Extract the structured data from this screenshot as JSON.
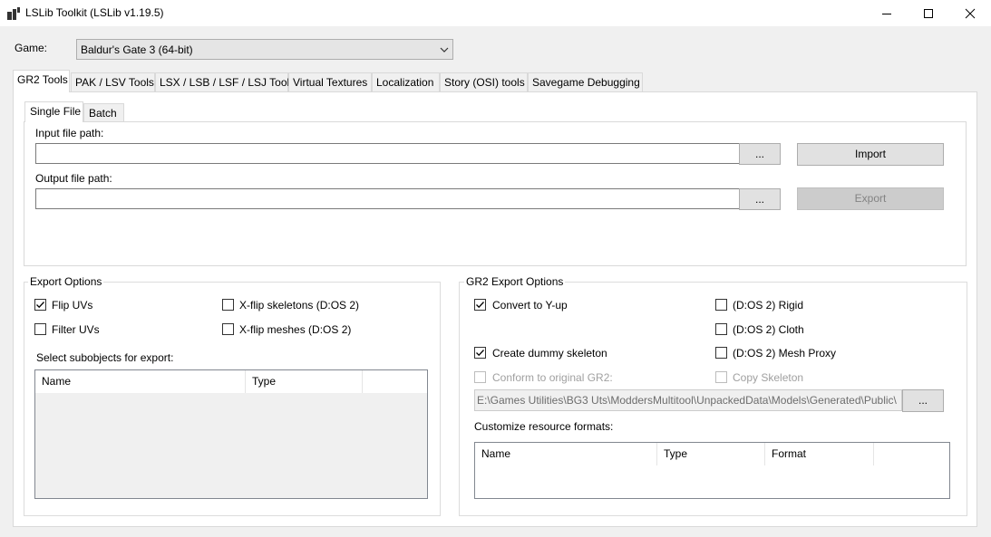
{
  "window": {
    "title": "LSLib Toolkit (LSLib v1.19.5)",
    "icon": "app-icon",
    "controls": [
      "minimize-icon",
      "maximize-icon",
      "close-icon"
    ]
  },
  "game": {
    "label": "Game:",
    "selected": "Baldur's Gate 3 (64-bit)"
  },
  "tabs": [
    {
      "label": "GR2 Tools",
      "active": true
    },
    {
      "label": "PAK / LSV Tools"
    },
    {
      "label": "LSX / LSB / LSF / LSJ Tools"
    },
    {
      "label": "Virtual Textures"
    },
    {
      "label": "Localization"
    },
    {
      "label": "Story (OSI) tools"
    },
    {
      "label": "Savegame Debugging"
    }
  ],
  "subtabs": [
    {
      "label": "Single File",
      "active": true
    },
    {
      "label": "Batch"
    }
  ],
  "single_file": {
    "input_label": "Input file path:",
    "input_value": "",
    "output_label": "Output file path:",
    "output_value": "",
    "browse_label": "...",
    "import_label": "Import",
    "export_label": "Export"
  },
  "export_options": {
    "title": "Export Options",
    "flip_uvs": {
      "label": "Flip UVs",
      "checked": true
    },
    "filter_uvs": {
      "label": "Filter UVs",
      "checked": false
    },
    "xflip_skeletons": {
      "label": "X-flip skeletons (D:OS 2)",
      "checked": false
    },
    "xflip_meshes": {
      "label": "X-flip meshes (D:OS 2)",
      "checked": false
    },
    "subobjects_label": "Select subobjects for export:",
    "columns": [
      "Name",
      "Type"
    ]
  },
  "gr2_export_options": {
    "title": "GR2 Export Options",
    "convert_yup": {
      "label": "Convert to Y-up",
      "checked": true
    },
    "create_dummy": {
      "label": "Create dummy skeleton",
      "checked": true
    },
    "conform": {
      "label": "Conform to original GR2:",
      "checked": false,
      "disabled": true
    },
    "rigid": {
      "label": "(D:OS 2) Rigid",
      "checked": false
    },
    "cloth": {
      "label": "(D:OS 2) Cloth",
      "checked": false
    },
    "mesh_proxy": {
      "label": "(D:OS 2) Mesh Proxy",
      "checked": false
    },
    "copy_skeleton": {
      "label": "Copy Skeleton",
      "checked": false,
      "disabled": true
    },
    "conform_path": "E:\\Games Utilities\\BG3 Uts\\ModdersMultitool\\UnpackedData\\Models\\Generated\\Public\\",
    "browse_label": "...",
    "resource_formats_label": "Customize resource formats:",
    "columns": [
      "Name",
      "Type",
      "Format"
    ]
  },
  "colors": {
    "window_bg": "#f0f0f0",
    "panel_bg": "#ffffff",
    "border": "#adadad",
    "disabled_text": "#838383"
  }
}
